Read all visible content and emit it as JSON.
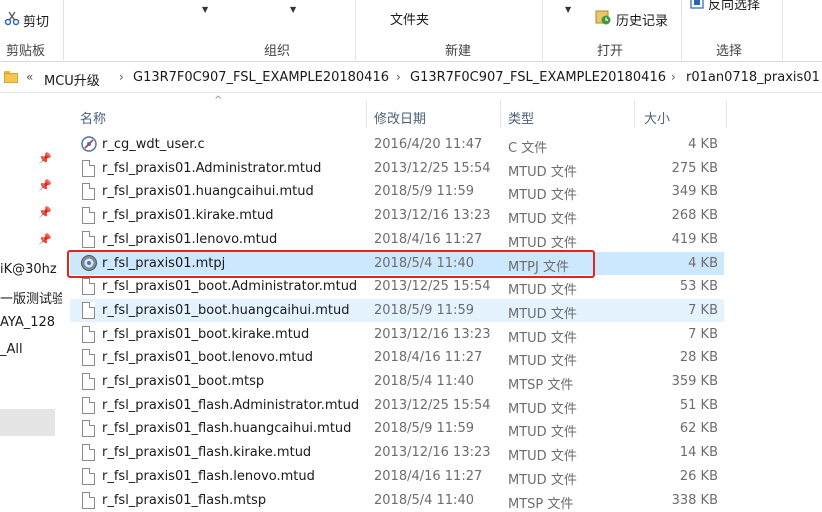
{
  "ribbon": {
    "cut_label": "剪切",
    "clipboard_group": "剪贴板",
    "organize_group": "组织",
    "folder_label": "文件夹",
    "new_group": "新建",
    "history_label": "历史记录",
    "open_group": "打开",
    "invert_select_label": "反向选择",
    "select_group": "选择"
  },
  "address": {
    "back_marker": "«",
    "segments": [
      "MCU升级",
      "G13R7F0C907_FSL_EXAMPLE20180416",
      "G13R7F0C907_FSL_EXAMPLE20180416",
      "r01an0718_praxis01"
    ]
  },
  "nav": {
    "items": [
      "iK@30hz",
      "一版测试验",
      "AYA_128",
      "_All"
    ]
  },
  "columns": {
    "name": "名称",
    "date": "修改日期",
    "type": "类型",
    "size": "大小"
  },
  "files": [
    {
      "name": "r_cg_wdt_user.c",
      "date": "2016/4/20 11:47",
      "type": "C 文件",
      "size": "4 KB",
      "icon": "c-file-icon"
    },
    {
      "name": "r_fsl_praxis01.Administrator.mtud",
      "date": "2013/12/25 15:54",
      "type": "MTUD 文件",
      "size": "275 KB",
      "icon": "file-icon"
    },
    {
      "name": "r_fsl_praxis01.huangcaihui.mtud",
      "date": "2018/5/9 11:59",
      "type": "MTUD 文件",
      "size": "349 KB",
      "icon": "file-icon"
    },
    {
      "name": "r_fsl_praxis01.kirake.mtud",
      "date": "2013/12/16 13:23",
      "type": "MTUD 文件",
      "size": "268 KB",
      "icon": "file-icon"
    },
    {
      "name": "r_fsl_praxis01.lenovo.mtud",
      "date": "2018/4/16 11:27",
      "type": "MTUD 文件",
      "size": "419 KB",
      "icon": "file-icon"
    },
    {
      "name": "r_fsl_praxis01.mtpj",
      "date": "2018/5/4 11:40",
      "type": "MTPJ 文件",
      "size": "4 KB",
      "icon": "project-icon"
    },
    {
      "name": "r_fsl_praxis01_boot.Administrator.mtud",
      "date": "2013/12/25 15:54",
      "type": "MTUD 文件",
      "size": "53 KB",
      "icon": "file-icon"
    },
    {
      "name": "r_fsl_praxis01_boot.huangcaihui.mtud",
      "date": "2018/5/9 11:59",
      "type": "MTUD 文件",
      "size": "7 KB",
      "icon": "file-icon"
    },
    {
      "name": "r_fsl_praxis01_boot.kirake.mtud",
      "date": "2013/12/16 13:23",
      "type": "MTUD 文件",
      "size": "7 KB",
      "icon": "file-icon"
    },
    {
      "name": "r_fsl_praxis01_boot.lenovo.mtud",
      "date": "2018/4/16 11:27",
      "type": "MTUD 文件",
      "size": "28 KB",
      "icon": "file-icon"
    },
    {
      "name": "r_fsl_praxis01_boot.mtsp",
      "date": "2018/5/4 11:40",
      "type": "MTSP 文件",
      "size": "359 KB",
      "icon": "file-icon"
    },
    {
      "name": "r_fsl_praxis01_flash.Administrator.mtud",
      "date": "2013/12/25 15:54",
      "type": "MTUD 文件",
      "size": "51 KB",
      "icon": "file-icon"
    },
    {
      "name": "r_fsl_praxis01_flash.huangcaihui.mtud",
      "date": "2018/5/9 11:59",
      "type": "MTUD 文件",
      "size": "62 KB",
      "icon": "file-icon"
    },
    {
      "name": "r_fsl_praxis01_flash.kirake.mtud",
      "date": "2013/12/16 13:23",
      "type": "MTUD 文件",
      "size": "14 KB",
      "icon": "file-icon"
    },
    {
      "name": "r_fsl_praxis01_flash.lenovo.mtud",
      "date": "2018/4/16 11:27",
      "type": "MTUD 文件",
      "size": "26 KB",
      "icon": "file-icon"
    },
    {
      "name": "r_fsl_praxis01_flash.mtsp",
      "date": "2018/5/4 11:40",
      "type": "MTSP 文件",
      "size": "338 KB",
      "icon": "file-icon"
    }
  ],
  "selected_index": 5,
  "hovered_index": 7,
  "colors": {
    "selection": "#cce8ff",
    "hover": "#e5f3ff",
    "highlight_box": "#e0261d"
  }
}
